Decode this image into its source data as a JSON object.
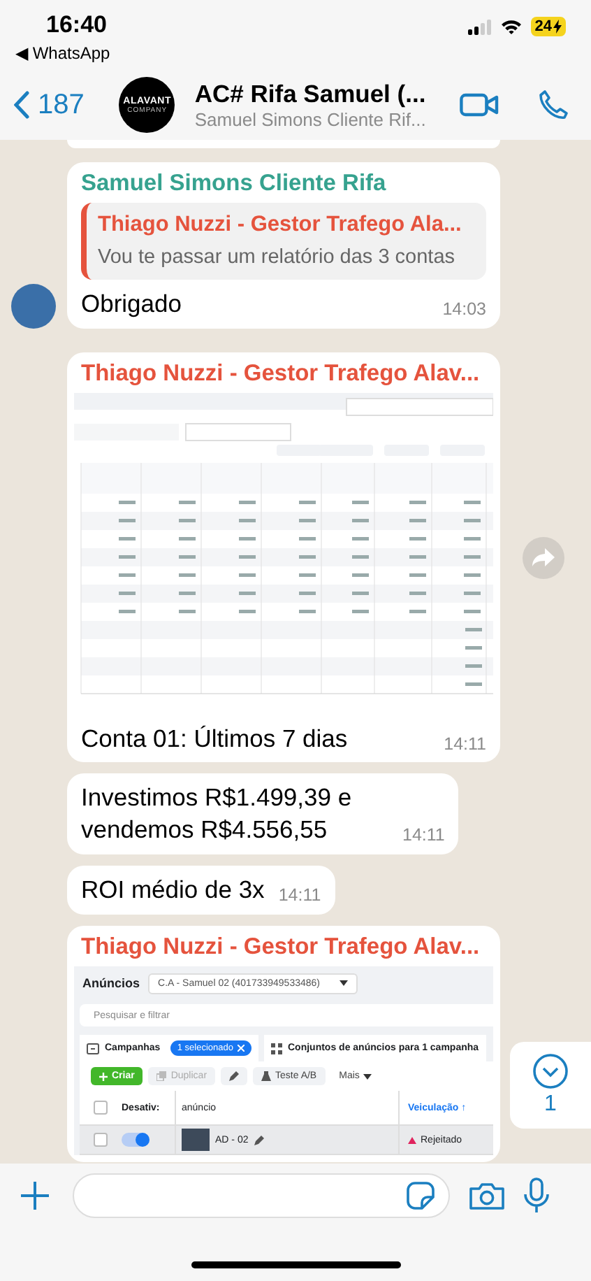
{
  "status_bar": {
    "time": "16:40",
    "back_app": "◀ WhatsApp",
    "battery": "24"
  },
  "header": {
    "back_count": "187",
    "avatar_text": "ALAVANT",
    "avatar_subtext": "COMPANY",
    "title": "AC# Rifa Samuel (...",
    "subtitle": "Samuel Simons Cliente Rif..."
  },
  "messages": [
    {
      "kind": "cut"
    },
    {
      "kind": "quote",
      "sender": "Samuel Simons Cliente Rifa",
      "quote_author": "Thiago Nuzzi - Gestor Trafego Ala...",
      "quote_text": "Vou te passar um relatório das 3 contas",
      "text": "Obrigado",
      "time": "14:03",
      "avatar": true
    },
    {
      "kind": "image",
      "sender": "Thiago Nuzzi - Gestor Trafego Alav...",
      "caption": "Conta 01: Últimos 7 dias",
      "time": "14:11",
      "forward": true
    },
    {
      "kind": "text",
      "text": "Investimos R$1.499,39 e vendemos R$4.556,55",
      "time": "14:11"
    },
    {
      "kind": "text",
      "text": "ROI médio de 3x",
      "time": "14:11"
    },
    {
      "kind": "ads",
      "sender": "Thiago Nuzzi - Gestor Trafego Alav...",
      "ads": {
        "section_label": "Anúncios",
        "account": "C.A - Samuel 02 (401733949533486)",
        "search_placeholder": "Pesquisar e filtrar",
        "tabs": [
          {
            "label": "Campanhas",
            "chip": "1 selecionado"
          },
          {
            "label": "Conjuntos de anúncios para 1 campanha"
          }
        ],
        "buttons": [
          {
            "kind": "primary",
            "label": "Criar"
          },
          {
            "kind": "disabled",
            "label": "Duplicar"
          },
          {
            "kind": "edit"
          },
          {
            "kind": "test",
            "label": "Teste A/B"
          },
          {
            "kind": "menu",
            "label": "Mais"
          }
        ],
        "all_checked": false,
        "columns": [
          "Desativ:",
          "anúncio",
          "Veiculação ↑"
        ],
        "rows": [
          {
            "checked": false,
            "on": true,
            "name": "AD - 02",
            "status": "Rejeitado"
          }
        ]
      }
    }
  ],
  "scroll_button": {
    "count": "1"
  }
}
